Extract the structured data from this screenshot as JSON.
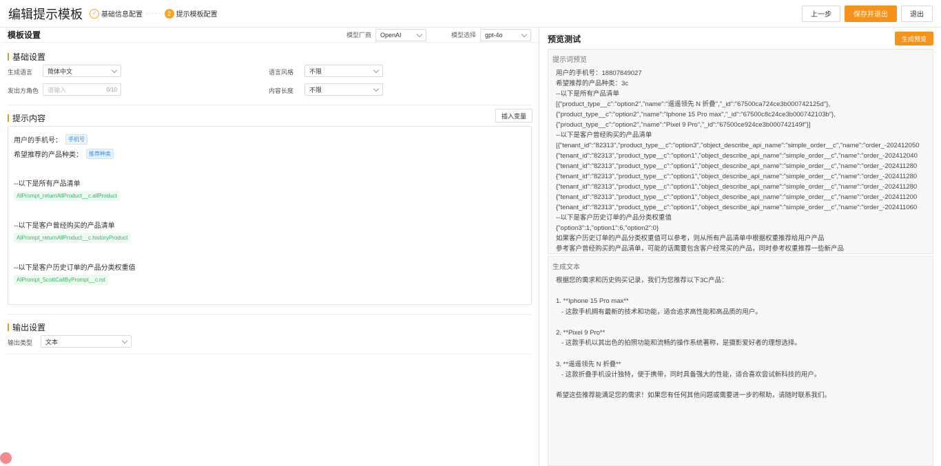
{
  "header": {
    "title": "编辑提示模板",
    "steps": [
      {
        "num": "",
        "label": "基础信息配置"
      },
      {
        "num": "2",
        "label": "提示模板配置"
      }
    ],
    "step_dots": "·····",
    "actions": {
      "prev": "上一步",
      "save_exit": "保存并退出",
      "exit": "退出"
    }
  },
  "template": {
    "title": "模板设置",
    "vendor_label": "模型厂商",
    "vendor_value": "OpenAI",
    "model_label": "模型选择",
    "model_value": "gpt-4o"
  },
  "basic": {
    "title": "基础设置",
    "lang_label": "生成语言",
    "lang_value": "简体中文",
    "style_label": "语言风格",
    "style_value": "不限",
    "role_label": "发出方角色",
    "role_placeholder": "请输入",
    "role_count": "0/10",
    "length_label": "内容长度",
    "length_value": "不限"
  },
  "prompt": {
    "title": "提示内容",
    "insert_var": "插入变量",
    "phone_text": "用户的手机号：",
    "phone_tag": "手机号",
    "kind_text": "希望推荐的产品种类：",
    "kind_tag": "推荐种类",
    "all_products_text": "--以下是所有产品清单",
    "all_products_var": "AIPrompt_returnAllProduct__c.allProduct",
    "history_text": "--以下是客户曾经购买的产品清单",
    "history_var": "AIPrompt_returnAllProduct__c.historyProduct",
    "weight_text": "--以下是客户历史订单的产品分类权重值",
    "weight_var": "AIPrompt_ScottCallByPrompt__c.rst"
  },
  "output": {
    "title": "输出设置",
    "type_label": "输出类型",
    "type_value": "文本"
  },
  "preview": {
    "title": "预览测试",
    "gen_button": "生成预览",
    "prompt_title": "提示词预览",
    "prompt_lines": [
      "用户的手机号：18807849027",
      "希望推荐的产品种类：3c",
      "--以下是所有产品清单",
      "[{\"product_type__c\":\"option2\",\"name\":\"遥遥领先 N 折叠\",\"_id\":\"67500ca724ce3b000742125d\"},",
      "{\"product_type__c\":\"option2\",\"name\":\"Iphone 15 Pro max\",\"_id\":\"67500c8c24ce3b000742103b\"},",
      "{\"product_type__c\":\"option2\",\"name\":\"Pixel 9 Pro\",\"_id\":\"67500ce924ce3b000742149f\"}]",
      "--以下是客户曾经购买的产品清单",
      "[{\"tenant_id\":\"82313\",\"product_type__c\":\"option3\",\"object_describe_api_name\":\"simple_order__c\",\"name\":\"order_-202412050",
      "{\"tenant_id\":\"82313\",\"product_type__c\":\"option1\",\"object_describe_api_name\":\"simple_order__c\",\"name\":\"order_-202412040",
      "{\"tenant_id\":\"82313\",\"product_type__c\":\"option1\",\"object_describe_api_name\":\"simple_order__c\",\"name\":\"order_-202411280",
      "{\"tenant_id\":\"82313\",\"product_type__c\":\"option1\",\"object_describe_api_name\":\"simple_order__c\",\"name\":\"order_-202411280",
      "{\"tenant_id\":\"82313\",\"product_type__c\":\"option1\",\"object_describe_api_name\":\"simple_order__c\",\"name\":\"order_-202411280",
      "{\"tenant_id\":\"82313\",\"product_type__c\":\"option1\",\"object_describe_api_name\":\"simple_order__c\",\"name\":\"order_-202411200",
      "{\"tenant_id\":\"82313\",\"product_type__c\":\"option1\",\"object_describe_api_name\":\"simple_order__c\",\"name\":\"order_-202411060",
      "--以下是客户历史订单的产品分类权重值",
      "{\"option3\":1,\"option1\":6,\"option2\":0}",
      "如果客户历史订单的产品分类权重值可以参考，则从所有产品清单中根据权重推荐给用户产品",
      "参考客户曾经购买的产品清单，可能的话需要包含客户经常买的产品，同时参考权重推荐一些新产品"
    ],
    "gen_title": "生成文本",
    "gen_lines": [
      "根据您的需求和历史购买记录，我们为您推荐以下3C产品：",
      "",
      "1. **Iphone 15 Pro max**",
      "   - 这款手机拥有最新的技术和功能，适合追求高性能和高品质的用户。",
      "",
      "2. **Pixel 9 Pro**",
      "   - 这款手机以其出色的拍照功能和流畅的操作系统著称，是摄影爱好者的理想选择。",
      "",
      "3. **遥遥领先 N 折叠**",
      "   - 这款折叠手机设计独特，便于携带，同时具备强大的性能，适合喜欢尝试新科技的用户。",
      "",
      "希望这些推荐能满足您的需求！如果您有任何其他问题或需要进一步的帮助，请随时联系我们。"
    ]
  }
}
